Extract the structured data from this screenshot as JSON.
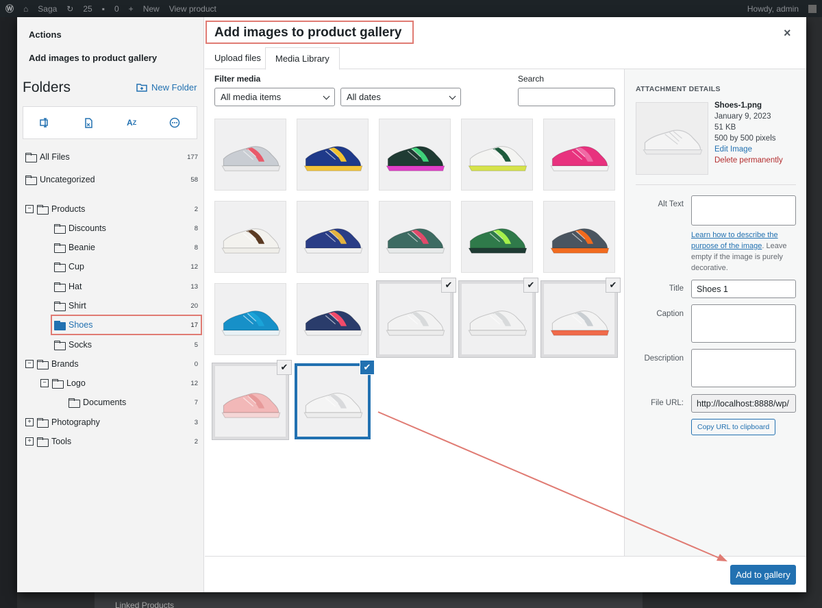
{
  "adminbar": {
    "site": "Saga",
    "updates": "25",
    "comments": "0",
    "new_label": "New",
    "view_label": "View product",
    "howdy": "Howdy, admin"
  },
  "background": {
    "linked_products": "Linked Products"
  },
  "modal": {
    "title": "Add images to product gallery",
    "close_glyph": "×"
  },
  "left": {
    "actions_heading": "Actions",
    "actions_item": "Add images to product gallery",
    "folders_heading": "Folders",
    "new_folder": "New Folder",
    "folders": [
      {
        "name": "All Files",
        "count": "177"
      },
      {
        "name": "Uncategorized",
        "count": "58"
      },
      {
        "name": "Products",
        "count": "2"
      },
      {
        "name": "Discounts",
        "count": "8"
      },
      {
        "name": "Beanie",
        "count": "8"
      },
      {
        "name": "Cup",
        "count": "12"
      },
      {
        "name": "Hat",
        "count": "13"
      },
      {
        "name": "Shirt",
        "count": "20"
      },
      {
        "name": "Shoes",
        "count": "17"
      },
      {
        "name": "Socks",
        "count": "5"
      },
      {
        "name": "Brands",
        "count": "0"
      },
      {
        "name": "Logo",
        "count": "12"
      },
      {
        "name": "Documents",
        "count": "7"
      },
      {
        "name": "Photography",
        "count": "3"
      },
      {
        "name": "Tools",
        "count": "2"
      }
    ]
  },
  "tabs": {
    "upload": "Upload files",
    "library": "Media Library"
  },
  "filter": {
    "heading": "Filter media",
    "type_value": "All media items",
    "date_value": "All dates",
    "search_label": "Search",
    "search_value": ""
  },
  "grid": {
    "thumbnails": [
      {
        "upper": "#c9cdd3",
        "accent": "#e85a6a",
        "sole": "#e9e9ea",
        "selected": false
      },
      {
        "upper": "#1f3a8a",
        "accent": "#f2c230",
        "sole": "#f3c43a",
        "selected": false
      },
      {
        "upper": "#1f3b33",
        "accent": "#3ed07a",
        "sole": "#e040c8",
        "selected": false
      },
      {
        "upper": "#f4f4f2",
        "accent": "#1e5a3c",
        "sole": "#d6e34a",
        "selected": false
      },
      {
        "upper": "#e8327e",
        "accent": "#f06aa5",
        "sole": "#f4f4f4",
        "selected": false
      },
      {
        "upper": "#f3f2ee",
        "accent": "#5a3a22",
        "sole": "#efeee9",
        "selected": false
      },
      {
        "upper": "#2a3d86",
        "accent": "#e3b33f",
        "sole": "#f0f0f0",
        "selected": false
      },
      {
        "upper": "#3d6b62",
        "accent": "#e04a6a",
        "sole": "#e6e9e9",
        "selected": false
      },
      {
        "upper": "#2f7a4a",
        "accent": "#a4f04a",
        "sole": "#1f3b33",
        "selected": false
      },
      {
        "upper": "#4a5560",
        "accent": "#f06a1e",
        "sole": "#f26b1f",
        "selected": false
      },
      {
        "upper": "#1790c8",
        "accent": "#1aa3d8",
        "sole": "#e9f2f6",
        "selected": false
      },
      {
        "upper": "#2a3c6b",
        "accent": "#f04a6a",
        "sole": "#f0f0f0",
        "selected": false
      },
      {
        "upper": "#f2f2f2",
        "accent": "#d8dadb",
        "sole": "#ececec",
        "selected": true
      },
      {
        "upper": "#f2f2f2",
        "accent": "#d8dadb",
        "sole": "#ececec",
        "selected": true
      },
      {
        "upper": "#f3f3f3",
        "accent": "#c9ced2",
        "sole": "#f06a4a",
        "selected": true
      },
      {
        "upper": "#f2b8b8",
        "accent": "#e79a9a",
        "sole": "#f5d6d6",
        "selected": true
      },
      {
        "upper": "#f4f4f4",
        "accent": "#d9dadc",
        "sole": "#ededed",
        "selected": true
      }
    ],
    "check_glyph": "✔"
  },
  "details": {
    "heading": "ATTACHMENT DETAILS",
    "filename": "Shoes-1.png",
    "date": "January 9, 2023",
    "size": "51 KB",
    "dimensions": "500 by 500 pixels",
    "edit": "Edit Image",
    "delete": "Delete permanently",
    "alt_label": "Alt Text",
    "alt_value": "",
    "help_link": "Learn how to describe the purpose of the image",
    "help_rest": ". Leave empty if the image is purely decorative.",
    "title_label": "Title",
    "title_value": "Shoes 1",
    "caption_label": "Caption",
    "caption_value": "",
    "description_label": "Description",
    "description_value": "",
    "url_label": "File URL:",
    "url_value": "http://localhost:8888/wp/",
    "copy_button": "Copy URL to clipboard"
  },
  "footer": {
    "add_button": "Add to gallery"
  },
  "colors": {
    "accent": "#2271b1",
    "highlight": "#e07b73",
    "danger": "#b32d2e"
  }
}
